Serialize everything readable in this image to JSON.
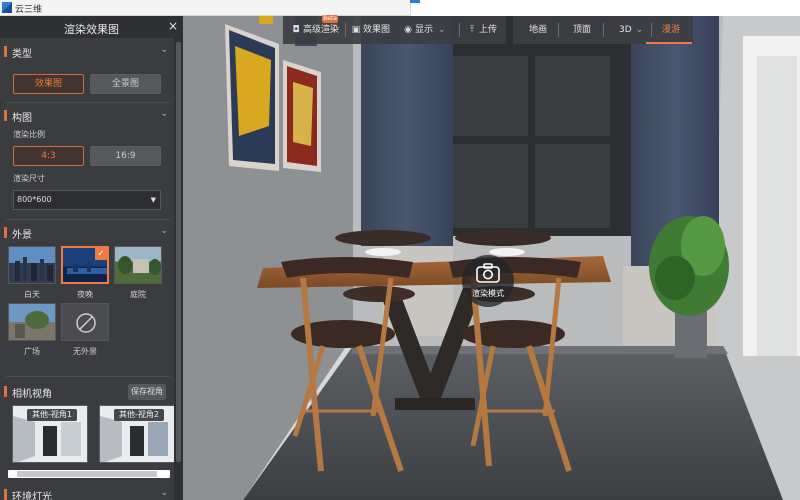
{
  "app": {
    "title": "云三维"
  },
  "panel": {
    "title": "渲染效果图",
    "close_icon": "×",
    "type_section": {
      "title": "类型",
      "options": [
        "效果图",
        "全景图"
      ],
      "selected": "效果图"
    },
    "composition_section": {
      "title": "构图",
      "ratio_label": "渲染比例",
      "ratios": [
        "4:3",
        "16:9"
      ],
      "selected_ratio": "4:3",
      "size_label": "渲染尺寸",
      "size_value": "800*600"
    },
    "exterior_section": {
      "title": "外景",
      "items": [
        "白天",
        "夜晚",
        "庭院",
        "广场",
        "无外景"
      ],
      "selected": "夜晚"
    },
    "camera_section": {
      "title": "相机视角",
      "save_button": "保存视角",
      "views": [
        "其他-视角1",
        "其他-视角2"
      ]
    },
    "lighting_section": {
      "title": "环境灯光"
    }
  },
  "toolbar": {
    "hd_render": "高级渲染",
    "beta": "Beta",
    "render_image": "效果图",
    "display": "显示",
    "upload": "上传",
    "modes": [
      "地画",
      "顶面",
      "3D",
      "漫游"
    ],
    "active_mode": "漫游"
  },
  "scene": {
    "render_mode_label": "渲染模式"
  },
  "colors": {
    "accent": "#f07a43",
    "panel_bg": "#3a3c3f"
  }
}
